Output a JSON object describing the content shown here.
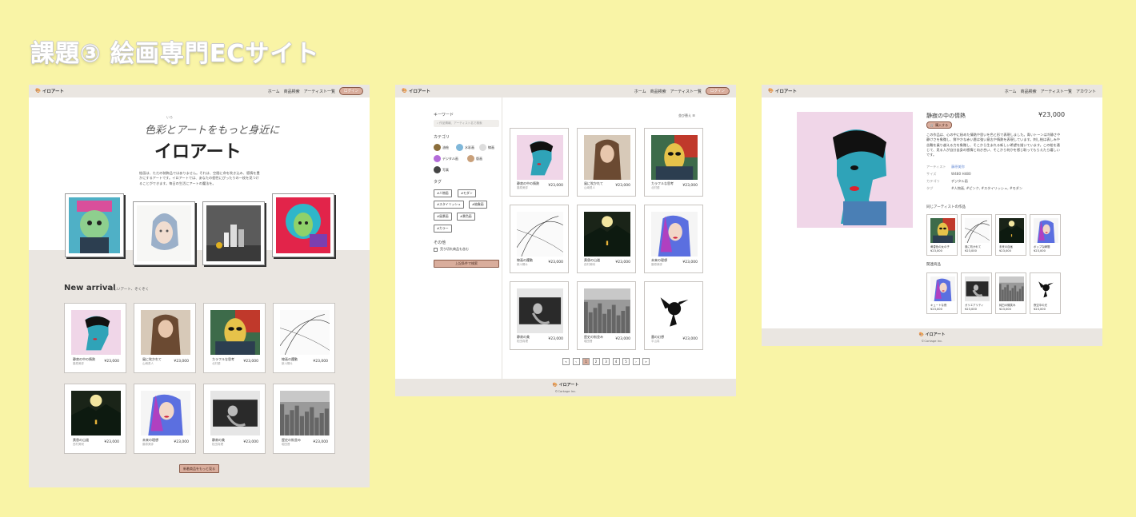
{
  "heading": "課題③ 絵画専門ECサイト",
  "nav": {
    "logo": "イロアート",
    "home": "ホーム",
    "search": "商品検索",
    "artists": "アーティスト一覧",
    "login": "ログイン",
    "account": "アカウント"
  },
  "home": {
    "tagline": "色彩とアートをもっと身近に",
    "ruby": "いろ",
    "hero_title": "イロアート",
    "intro": "絵画は、ただの装飾品ではありません。それは、空間に命を吹き込み、感情を豊かにするアートです。イロアートでは、あなたの個性にぴったりの一枚を見つけることができます。毎日の生活にアートの魔法を。",
    "new_arrival": "New arrival",
    "new_arrival_sub": "新しいアート、ぞくぞく",
    "more_button": "新着商品をもっと見る",
    "items": [
      {
        "title": "静寂の中の情熱",
        "artist": "藤原美弥",
        "price": "¥23,000"
      },
      {
        "title": "風に吹かれて",
        "artist": "山崎勇人",
        "price": "¥23,000"
      },
      {
        "title": "カラフルな思考",
        "artist": "北村優",
        "price": "¥23,000"
      },
      {
        "title": "線画の躍動",
        "artist": "新川陽斗",
        "price": "¥23,000"
      },
      {
        "title": "黄昏の山道",
        "artist": "西村美咲",
        "price": "¥23,000"
      },
      {
        "title": "未来の理想",
        "artist": "藤原美弥",
        "price": "¥23,000"
      },
      {
        "title": "静寂の美",
        "artist": "松田真理",
        "price": "¥23,000"
      },
      {
        "title": "歴史の街並み",
        "artist": "堀田晋",
        "price": "¥23,000"
      }
    ]
  },
  "search": {
    "keyword_label": "キーワード",
    "keyword_placeholder": "作品情報、アーティスト名で検索",
    "category_label": "カテゴリ",
    "categories": [
      "油絵",
      "水彩画",
      "線画",
      "デジタル画",
      "版画",
      "写真"
    ],
    "tag_label": "タグ",
    "tags": [
      "#人物画",
      "#モダン",
      "#スタイリッシュ",
      "#抽象画",
      "#風景画",
      "#景色画",
      "#カラー"
    ],
    "other_label": "その他",
    "other_check": "売り切れ商品も含む",
    "submit": "上記条件で検索",
    "sort": "並び替え",
    "items": [
      {
        "title": "静寂の中の情熱",
        "artist": "藤原美弥",
        "price": "¥23,000"
      },
      {
        "title": "風に吹かれて",
        "artist": "山崎勇人",
        "price": "¥23,000"
      },
      {
        "title": "カラフルな思考",
        "artist": "北村優",
        "price": "¥23,000"
      },
      {
        "title": "線画の躍動",
        "artist": "新川陽斗",
        "price": "¥23,000"
      },
      {
        "title": "黄昏の山道",
        "artist": "西村美咲",
        "price": "¥23,000"
      },
      {
        "title": "未来の理想",
        "artist": "藤原美弥",
        "price": "¥23,000"
      },
      {
        "title": "静寂の美",
        "artist": "松田真理",
        "price": "¥23,000"
      },
      {
        "title": "歴史の街並み",
        "artist": "堀田晋",
        "price": "¥23,000"
      },
      {
        "title": "墨の幻想",
        "artist": "平山真",
        "price": "¥23,000"
      }
    ],
    "pages": [
      "«",
      "‹",
      "1",
      "2",
      "3",
      "4",
      "5",
      "›",
      "»"
    ]
  },
  "detail": {
    "title": "静寂の中の情熱",
    "price": "¥23,000",
    "buy": "購入する",
    "description": "この作品は、心の中に秘めた情熱や思いを色と形で表現しました。青いトーンは冷静さや静けさを象徴し、鮮やかな赤い唇は強い意志や情熱を表現しています。刺し絵は表しみや苦難を乗り越える力を象徴し、そこから生まれる新しい希望を描いています。この絵を通じて、見る人が自分自身の感情と向き合い、そこから何かを感じ取ってもらえたら嬉しいです。",
    "meta": [
      {
        "k": "アーティスト",
        "v": "藤原美弥"
      },
      {
        "k": "サイズ",
        "v": "W480 H480"
      },
      {
        "k": "カテゴリ",
        "v": "デジタル画"
      },
      {
        "k": "タグ",
        "v": "#人物画, #ピンク, #スタイリッシュ, #モダン"
      }
    ],
    "same_artist": "同じアーティストの作品",
    "same_items": [
      {
        "title": "黄昏色の女の子",
        "price": "¥23,000"
      },
      {
        "title": "風に吹かれて",
        "price": "¥23,000"
      },
      {
        "title": "未来の自画",
        "price": "¥23,000"
      },
      {
        "title": "ポップな瞬間",
        "price": "¥23,000"
      }
    ],
    "related": "関連商品",
    "related_items": [
      {
        "title": "キュートな夜",
        "price": "¥23,000"
      },
      {
        "title": "ガリエアリティ",
        "price": "¥23,000"
      },
      {
        "title": "純白の微笑み",
        "price": "¥23,000"
      },
      {
        "title": "夜空中の光",
        "price": "¥23,000"
      }
    ]
  },
  "footer": {
    "logo": "イロアート",
    "copy": "©Cortage Inc."
  },
  "colors": {
    "background": "#f9f4a6",
    "accent": "#d9ad9c",
    "nav": "#eae6e1"
  }
}
